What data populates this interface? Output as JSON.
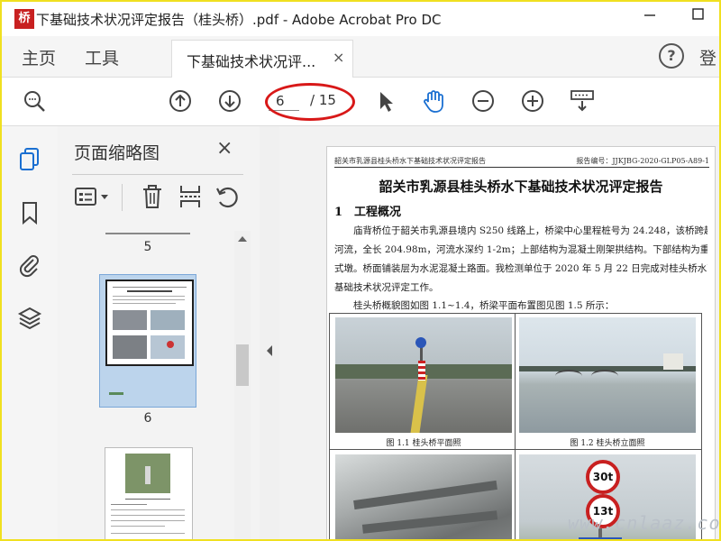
{
  "window": {
    "title": "下基础技术状况评定报告（桂头桥）.pdf - Adobe Acrobat Pro DC",
    "logo_text": "桥"
  },
  "tabs": {
    "home": "主页",
    "tools": "工具",
    "document": "下基础技术状况评...",
    "close": "×",
    "truncated": "登"
  },
  "toolbar": {
    "current_page": "6",
    "total_pages": "/ 15"
  },
  "panel": {
    "title": "页面缩略图",
    "close": "×",
    "thumbnails": [
      {
        "label": "5"
      },
      {
        "label": "6"
      }
    ]
  },
  "document": {
    "header_left": "韶关市乳源县桂头桥水下基础技术状况评定报告",
    "header_right": "报告编号：JJKJBG-2020-GLP05-A89-1",
    "title": "韶关市乳源县桂头桥水下基础技术状况评定报告",
    "section": "1　工程概况",
    "paragraph_lines": [
      "庙背桥位于韶关市乳源县境内 S250 线路上，桥梁中心里程桩号为 24.248，该桥跨越",
      "河流，全长 204.98m，河流水深约 1-2m；上部结构为混凝土刚架拱结构。下部结构为重力",
      "式墩。桥面铺装层为水泥混凝土路面。我检测单位于 2020 年 5 月 22 日完成对桂头桥水下",
      "基础技术状况评定工作。"
    ],
    "figure_intro": "桂头桥概貌图如图 1.1~1.4，桥梁平面布置图见图 1.5 所示：",
    "figure_captions": [
      "图 1.1  桂头桥平面照",
      "图 1.2  桂头桥立面照"
    ]
  },
  "watermark": "www.cnlaaz.com"
}
